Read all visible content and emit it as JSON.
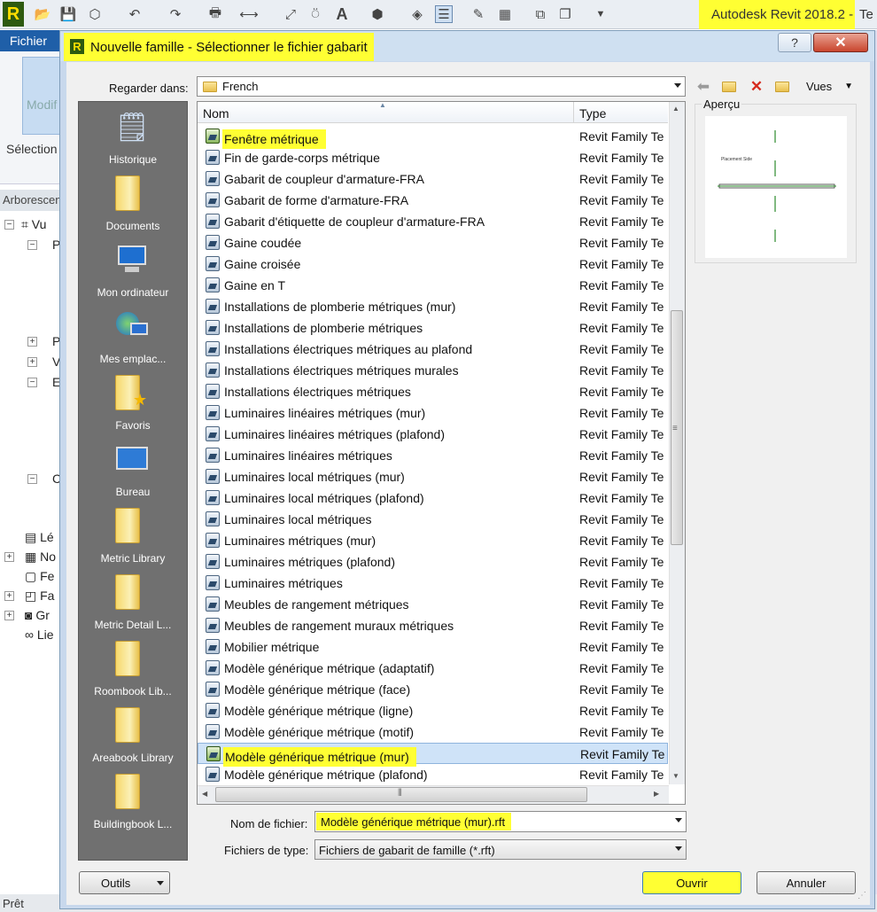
{
  "app": {
    "logo": "R",
    "title": "Autodesk Revit 2018.2 -",
    "title_cut": "Te",
    "menu_tab": "Fichier",
    "modify_label": "Modif",
    "selection_label": "Sélection",
    "browser_header": "Arborescence",
    "tree": [
      "Vu",
      "P",
      "P",
      "V",
      "E",
      "C",
      "Lé",
      "No",
      "Fe",
      "Fa",
      "Gr",
      "Lie"
    ],
    "status": "Prêt"
  },
  "dialog": {
    "title": "Nouvelle famille - Sélectionner le fichier gabarit",
    "help_label": "?",
    "close_label": "✕",
    "look_in_label": "Regarder dans:",
    "look_in_value": "French",
    "views_label": "Vues",
    "preview_label": "Aperçu",
    "preview_text": "Placement Side",
    "places": [
      {
        "label": "Historique",
        "icon": "history-icon"
      },
      {
        "label": "Documents",
        "icon": "documents-folder-icon"
      },
      {
        "label": "Mon ordinateur",
        "icon": "computer-icon"
      },
      {
        "label": "Mes emplac...",
        "icon": "network-places-icon"
      },
      {
        "label": "Favoris",
        "icon": "favorites-folder-icon"
      },
      {
        "label": "Bureau",
        "icon": "desktop-icon"
      },
      {
        "label": "Metric Library",
        "icon": "folder-icon"
      },
      {
        "label": "Metric Detail L...",
        "icon": "folder-icon"
      },
      {
        "label": "Roombook Lib...",
        "icon": "folder-icon"
      },
      {
        "label": "Areabook Library",
        "icon": "folder-icon"
      },
      {
        "label": "Buildingbook L...",
        "icon": "folder-icon"
      }
    ],
    "columns": {
      "name": "Nom",
      "type": "Type"
    },
    "files": [
      {
        "name": "Fenêtre métrique",
        "type": "Revit Family Te"
      },
      {
        "name": "Fin de garde-corps métrique",
        "type": "Revit Family Te"
      },
      {
        "name": "Gabarit de coupleur d'armature-FRA",
        "type": "Revit Family Te"
      },
      {
        "name": "Gabarit de forme d'armature-FRA",
        "type": "Revit Family Te"
      },
      {
        "name": "Gabarit d'étiquette de coupleur d'armature-FRA",
        "type": "Revit Family Te"
      },
      {
        "name": "Gaine coudée",
        "type": "Revit Family Te"
      },
      {
        "name": "Gaine croisée",
        "type": "Revit Family Te"
      },
      {
        "name": "Gaine en T",
        "type": "Revit Family Te"
      },
      {
        "name": "Installations de plomberie métriques (mur)",
        "type": "Revit Family Te"
      },
      {
        "name": "Installations de plomberie métriques",
        "type": "Revit Family Te"
      },
      {
        "name": "Installations électriques métriques au plafond",
        "type": "Revit Family Te"
      },
      {
        "name": "Installations électriques métriques murales",
        "type": "Revit Family Te"
      },
      {
        "name": "Installations électriques métriques",
        "type": "Revit Family Te"
      },
      {
        "name": "Luminaires linéaires métriques (mur)",
        "type": "Revit Family Te"
      },
      {
        "name": "Luminaires linéaires métriques (plafond)",
        "type": "Revit Family Te"
      },
      {
        "name": "Luminaires linéaires métriques",
        "type": "Revit Family Te"
      },
      {
        "name": "Luminaires local métriques (mur)",
        "type": "Revit Family Te"
      },
      {
        "name": "Luminaires local métriques (plafond)",
        "type": "Revit Family Te"
      },
      {
        "name": "Luminaires local métriques",
        "type": "Revit Family Te"
      },
      {
        "name": "Luminaires métriques (mur)",
        "type": "Revit Family Te"
      },
      {
        "name": "Luminaires métriques (plafond)",
        "type": "Revit Family Te"
      },
      {
        "name": "Luminaires métriques",
        "type": "Revit Family Te"
      },
      {
        "name": "Meubles de rangement métriques",
        "type": "Revit Family Te"
      },
      {
        "name": "Meubles de rangement muraux métriques",
        "type": "Revit Family Te"
      },
      {
        "name": "Mobilier métrique",
        "type": "Revit Family Te"
      },
      {
        "name": "Modèle générique métrique (adaptatif)",
        "type": "Revit Family Te"
      },
      {
        "name": "Modèle générique métrique (face)",
        "type": "Revit Family Te"
      },
      {
        "name": "Modèle générique métrique (ligne)",
        "type": "Revit Family Te"
      },
      {
        "name": "Modèle générique métrique (motif)",
        "type": "Revit Family Te"
      },
      {
        "name": "Modèle générique métrique (mur)",
        "type": "Revit Family Te"
      },
      {
        "name": "Modèle générique métrique (plafond)",
        "type": "Revit Family Te"
      }
    ],
    "selected_file": "Modèle générique métrique (mur)",
    "filename_label": "Nom de fichier:",
    "filename_value": "Modèle générique métrique (mur).rft",
    "filetype_label": "Fichiers de type:",
    "filetype_value": "Fichiers de gabarit de famille  (*.rft)",
    "tools_label": "Outils",
    "open_label": "Ouvrir",
    "cancel_label": "Annuler"
  },
  "colors": {
    "highlight": "#ffff33",
    "selection": "#cfe3f8",
    "places_bg": "#707070",
    "title_bar": "#cfe0f1"
  }
}
